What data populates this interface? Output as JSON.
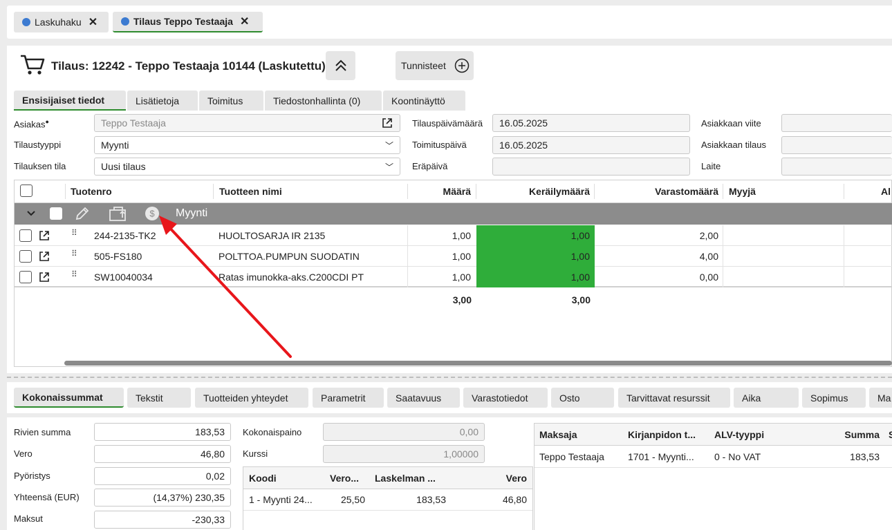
{
  "top_tabs": [
    {
      "label": "Laskuhaku"
    },
    {
      "label": "Tilaus Teppo Testaaja"
    }
  ],
  "header": {
    "title": "Tilaus: 12242 - Teppo Testaaja 10144 (Laskutettu)",
    "tags_button": "Tunnisteet"
  },
  "tabs": [
    "Ensisijaiset tiedot",
    "Lisätietoja",
    "Toimitus",
    "Tiedostonhallinta (0)",
    "Koontinäyttö"
  ],
  "form": {
    "customer_label": "Asiakas",
    "customer_value": "Teppo Testaaja",
    "order_type_label": "Tilaustyyppi",
    "order_type_value": "Myynti",
    "order_state_label": "Tilauksen tila",
    "order_state_value": "Uusi tilaus",
    "order_date_label": "Tilauspäivämäärä",
    "order_date_value": "16.05.2025",
    "delivery_date_label": "Toimituspäivä",
    "delivery_date_value": "16.05.2025",
    "due_date_label": "Eräpäivä",
    "due_date_value": "",
    "customer_ref_label": "Asiakkaan viite",
    "customer_order_label": "Asiakkaan tilaus",
    "device_label": "Laite"
  },
  "grid": {
    "columns": [
      "Tuotenro",
      "Tuotteen nimi",
      "Määrä",
      "Keräilymäärä",
      "Varastomäärä",
      "Myyjä",
      "Al"
    ],
    "group_label": "Myynti",
    "rows": [
      {
        "code": "244-2135-TK2",
        "name": "HUOLTOSARJA IR 2135",
        "qty": "1,00",
        "picked": "1,00",
        "stock": "2,00"
      },
      {
        "code": "505-FS180",
        "name": "POLTTOA.PUMPUN SUODATIN",
        "qty": "1,00",
        "picked": "1,00",
        "stock": "4,00"
      },
      {
        "code": "SW10040034",
        "name": "Ratas imunokka-aks.C200CDI PT",
        "qty": "1,00",
        "picked": "1,00",
        "stock": "0,00"
      }
    ],
    "total_qty": "3,00",
    "total_picked": "3,00"
  },
  "bottom_tabs": [
    "Kokonaissummat",
    "Tekstit",
    "Tuotteiden yhteydet",
    "Parametrit",
    "Saatavuus",
    "Varastotiedot",
    "Osto",
    "Tarvittavat resurssit",
    "Aika",
    "Sopimus",
    "Ma"
  ],
  "totals": {
    "rows_sum_label": "Rivien summa",
    "rows_sum": "183,53",
    "tax_label": "Vero",
    "tax": "46,80",
    "rounding_label": "Pyöristys",
    "rounding": "0,02",
    "total_label": "Yhteensä (EUR)",
    "total": "(14,37%) 230,35",
    "payments_label": "Maksut",
    "payments": "-230,33",
    "weight_label": "Kokonaispaino",
    "weight": "0,00",
    "rate_label": "Kurssi",
    "rate": "1,00000"
  },
  "vat_table": {
    "columns": [
      "Koodi",
      "Vero...",
      "Laskelman ...",
      "Vero"
    ],
    "row": [
      "1 - Myynti 24...",
      "25,50",
      "183,53",
      "46,80"
    ]
  },
  "payer_table": {
    "columns": [
      "Maksaja",
      "Kirjanpidon t...",
      "ALV-tyyppi",
      "Summa",
      "S"
    ],
    "row": [
      "Teppo Testaaja",
      "1701 - Myynti...",
      "0 - No VAT",
      "183,53"
    ]
  },
  "colors": {
    "accent_green": "#2fad3a",
    "tab_underline": "#2e8b2e",
    "annotation_arrow": "#e8161b",
    "tab_dot": "#3c7bd1"
  }
}
